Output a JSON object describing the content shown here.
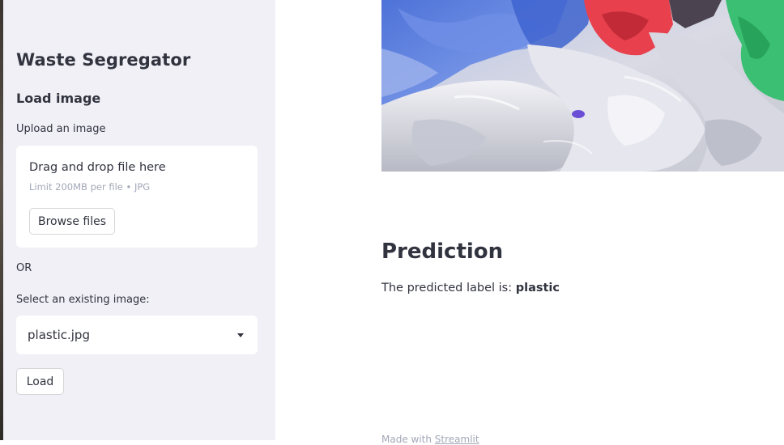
{
  "sidebar": {
    "title": "Waste Segregator",
    "subtitle": "Load image",
    "upload_label": "Upload an image",
    "uploader": {
      "drop_text": "Drag and drop file here",
      "limit_text": "Limit 200MB per file • JPG",
      "browse_label": "Browse files"
    },
    "or_text": "OR",
    "select_label": "Select an existing image:",
    "select_value": "plastic.jpg",
    "load_label": "Load"
  },
  "main": {
    "image_alt": "Plastic bags",
    "prediction_heading": "Prediction",
    "prediction_prefix": "The predicted label is: ",
    "prediction_value": "plastic",
    "footer_prefix": "Made with ",
    "footer_link": "Streamlit"
  },
  "colors": {
    "sidebar_bg": "#f0f0f6",
    "text": "#31333f",
    "muted": "#a3a8b8"
  }
}
